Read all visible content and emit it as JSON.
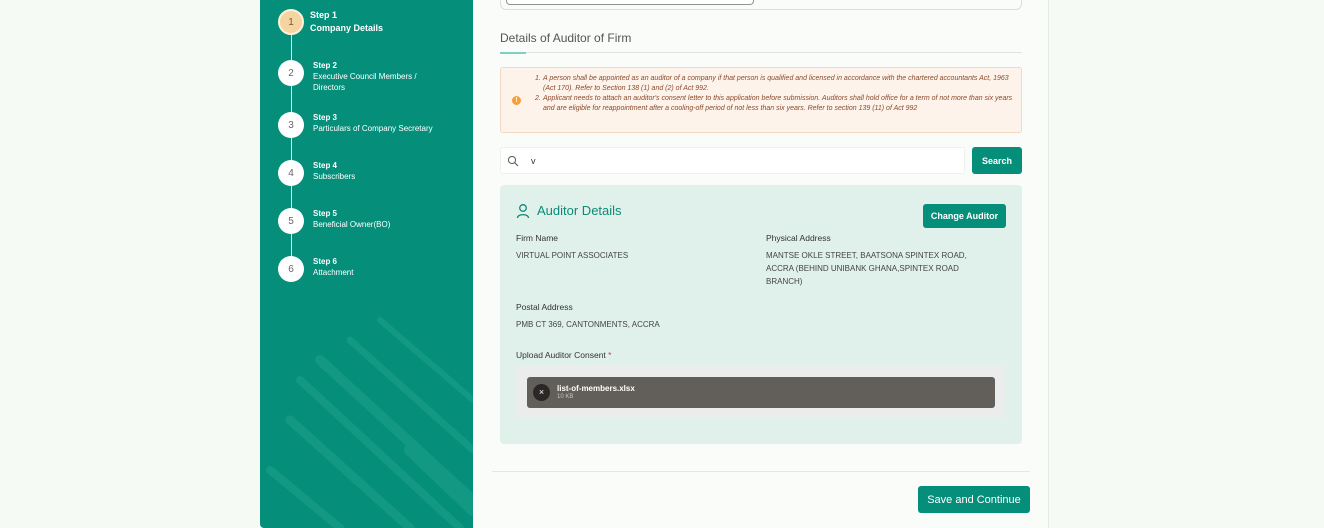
{
  "steps": [
    {
      "number": "1",
      "title": "Step 1",
      "label": "Company Details"
    },
    {
      "number": "2",
      "title": "Step 2",
      "label": "Executive Council Members / Directors"
    },
    {
      "number": "3",
      "title": "Step 3",
      "label": "Particulars of Company Secretary"
    },
    {
      "number": "4",
      "title": "Step 4",
      "label": "Subscribers"
    },
    {
      "number": "5",
      "title": "Step 5",
      "label": "Beneficial Owner(BO)"
    },
    {
      "number": "6",
      "title": "Step 6",
      "label": "Attachment"
    }
  ],
  "section": {
    "title": "Details of Auditor of Firm"
  },
  "notice": {
    "items": [
      {
        "num": "1.",
        "text": "A person shall be appointed as an auditor of a company if that person is qualified and licensed in accordance with the chartered accountants Act, 1963 (Act 170). Refer to Section 138 (1) and (2) of Act 992."
      },
      {
        "num": "2.",
        "text": "Applicant needs to attach an auditor's consent letter to this application before submission. Auditors shall hold office for a term of not more than six years and are eligible for reappointment after a cooling-off period of not less than six years. Refer to section 139 (11) of Act 992"
      }
    ]
  },
  "search": {
    "value": "v",
    "button_label": "Search"
  },
  "auditor": {
    "title": "Auditor Details",
    "change_label": "Change Auditor",
    "firm_name_label": "Firm Name",
    "firm_name": "VIRTUAL POINT ASSOCIATES",
    "physical_address_label": "Physical Address",
    "physical_address": "MANTSE OKLE STREET, BAATSONA SPINTEX ROAD, ACCRA (BEHIND UNIBANK GHANA,SPINTEX ROAD BRANCH)",
    "postal_address_label": "Postal Address",
    "postal_address": "PMB CT 369, CANTONMENTS, ACCRA",
    "upload_label": "Upload Auditor Consent",
    "required_mark": "*",
    "file": {
      "name": "list-of-members.xlsx",
      "size": "10 KB"
    }
  },
  "footer": {
    "save_label": "Save and Continue"
  },
  "colors": {
    "primary": "#058f7b",
    "active_step": "#f6d4a2",
    "notice_bg": "#fdf3ea",
    "card_bg": "#e0f1ec"
  }
}
